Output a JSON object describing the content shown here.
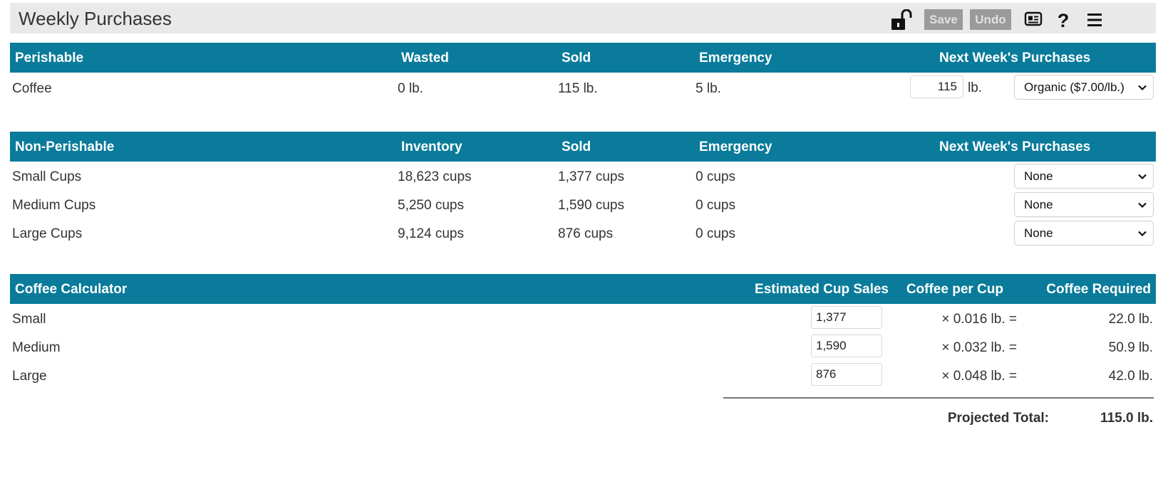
{
  "app": {
    "title": "Weekly Purchases",
    "save_label": "Save",
    "undo_label": "Undo"
  },
  "perishable": {
    "headers": {
      "item": "Perishable",
      "wasted": "Wasted",
      "sold": "Sold",
      "emergency": "Emergency",
      "next": "Next Week's Purchases"
    },
    "rows": [
      {
        "item": "Coffee",
        "wasted": "0 lb.",
        "sold": "115 lb.",
        "emergency": "5 lb.",
        "purchase_qty": "115",
        "purchase_unit": "lb.",
        "purchase_type": "Organic ($7.00/lb.)"
      }
    ]
  },
  "nonperishable": {
    "headers": {
      "item": "Non-Perishable",
      "inventory": "Inventory",
      "sold": "Sold",
      "emergency": "Emergency",
      "next": "Next Week's Purchases"
    },
    "rows": [
      {
        "item": "Small Cups",
        "inventory": "18,623 cups",
        "sold": "1,377 cups",
        "emergency": "0 cups",
        "purchase": "None"
      },
      {
        "item": "Medium Cups",
        "inventory": "5,250 cups",
        "sold": "1,590 cups",
        "emergency": "0 cups",
        "purchase": "None"
      },
      {
        "item": "Large Cups",
        "inventory": "9,124 cups",
        "sold": "876 cups",
        "emergency": "0 cups",
        "purchase": "None"
      }
    ]
  },
  "calculator": {
    "headers": {
      "title": "Coffee Calculator",
      "sales": "Estimated Cup Sales",
      "per_cup": "Coffee per Cup",
      "required": "Coffee Required"
    },
    "rows": [
      {
        "size": "Small",
        "sales": "1,377",
        "per_cup": "× 0.016 lb. =",
        "required": "22.0 lb."
      },
      {
        "size": "Medium",
        "sales": "1,590",
        "per_cup": "× 0.032 lb. =",
        "required": "50.9 lb."
      },
      {
        "size": "Large",
        "sales": "876",
        "per_cup": "× 0.048 lb. =",
        "required": "42.0 lb."
      }
    ],
    "total_label": "Projected Total:",
    "total_value": "115.0 lb."
  },
  "colors": {
    "header_bg": "#0a7b9a",
    "titlebar_bg": "#e9e9e9",
    "disabled_button": "#9a9a9a"
  },
  "icons": [
    "unlock-icon",
    "report-icon",
    "help-icon",
    "menu-icon",
    "chevron-down-icon"
  ]
}
